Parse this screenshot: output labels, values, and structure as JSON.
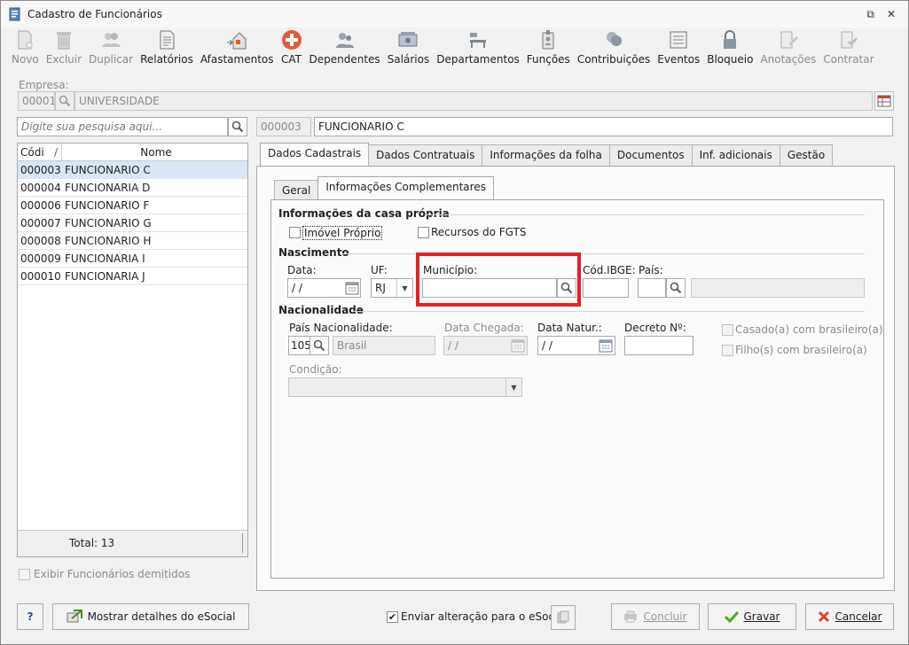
{
  "window": {
    "title": "Cadastro de Funcionários",
    "restore_glyph": "⧉",
    "close_glyph": "✕"
  },
  "toolbar": {
    "items": [
      {
        "label": "Novo",
        "icon": "new-doc-icon",
        "enabled": false
      },
      {
        "label": "Excluir",
        "icon": "trash-icon",
        "enabled": false
      },
      {
        "label": "Duplicar",
        "icon": "duplicate-users-icon",
        "enabled": false
      },
      {
        "label": "Relatórios",
        "icon": "report-icon",
        "enabled": true
      },
      {
        "label": "Afastamentos",
        "icon": "leave-house-icon",
        "enabled": true
      },
      {
        "label": "CAT",
        "icon": "medical-cross-icon",
        "enabled": true
      },
      {
        "label": "Dependentes",
        "icon": "dependents-icon",
        "enabled": true
      },
      {
        "label": "Salários",
        "icon": "salary-icon",
        "enabled": true
      },
      {
        "label": "Departamentos",
        "icon": "departments-icon",
        "enabled": true
      },
      {
        "label": "Funções",
        "icon": "badge-icon",
        "enabled": true
      },
      {
        "label": "Contribuições",
        "icon": "contributions-icon",
        "enabled": true
      },
      {
        "label": "Eventos",
        "icon": "events-list-icon",
        "enabled": true
      },
      {
        "label": "Bloqueio",
        "icon": "lock-icon",
        "enabled": true
      },
      {
        "label": "Anotações",
        "icon": "notes-icon",
        "enabled": false
      },
      {
        "label": "Contratar",
        "icon": "hire-icon",
        "enabled": false
      }
    ]
  },
  "empresa": {
    "label": "Empresa:",
    "code": "00001",
    "name": "UNIVERSIDADE"
  },
  "search": {
    "placeholder": "Digite sua pesquisa aqui..."
  },
  "employee": {
    "code": "000003",
    "name": "FUNCIONARIO C"
  },
  "grid": {
    "columns": [
      "Códi",
      "Nome"
    ],
    "sort_glyph": "/",
    "rows": [
      {
        "code": "000003",
        "name": "FUNCIONARIO C",
        "selected": true
      },
      {
        "code": "000004",
        "name": "FUNCIONARIA D",
        "selected": false
      },
      {
        "code": "000006",
        "name": "FUNCIONARIO F",
        "selected": false
      },
      {
        "code": "000007",
        "name": "FUNCIONARIO G",
        "selected": false
      },
      {
        "code": "000008",
        "name": "FUNCIONARIO H",
        "selected": false
      },
      {
        "code": "000009",
        "name": "FUNCIONARIA I",
        "selected": false
      },
      {
        "code": "000010",
        "name": "FUNCIONARIA J",
        "selected": false
      }
    ],
    "total": "Total: 13"
  },
  "show_dismissed": "Exibir Funcionários demitidos",
  "main_tabs": [
    "Dados Cadastrais",
    "Dados Contratuais",
    "Informações da folha",
    "Documentos",
    "Inf. adicionais",
    "Gestão"
  ],
  "sub_tabs": [
    "Geral",
    "Informações Complementares"
  ],
  "casa_propria": {
    "title": "Informações da casa própria",
    "imovel": "Imóvel Próprio",
    "fgts": "Recursos do FGTS"
  },
  "nascimento": {
    "title": "Nascimento",
    "data_label": "Data:",
    "data_value": " /  /",
    "uf_label": "UF:",
    "uf_value": "RJ",
    "municipio_label": "Município:",
    "municipio_value": "",
    "ibge_label": "Cód.IBGE:",
    "pais_label": "País:"
  },
  "nacionalidade": {
    "title": "Nacionalidade",
    "pais_label": "País Nacionalidade:",
    "pais_code": "105",
    "pais_name": "Brasil",
    "chegada_label": "Data Chegada:",
    "chegada_value": " /  /",
    "natur_label": "Data Natur.:",
    "natur_value": " /  /",
    "decreto_label": "Decreto Nº:",
    "casado": "Casado(a) com brasileiro(a)",
    "filhos": "Filho(s) com brasileiro(a)",
    "condicao_label": "Condição:"
  },
  "bottom": {
    "help": "?",
    "esocial_details": "Mostrar detalhes do eSocial",
    "enviar": "Enviar alteração para o eSocial",
    "concluir": "Concluir",
    "gravar": "Gravar",
    "cancelar": "Cancelar"
  }
}
